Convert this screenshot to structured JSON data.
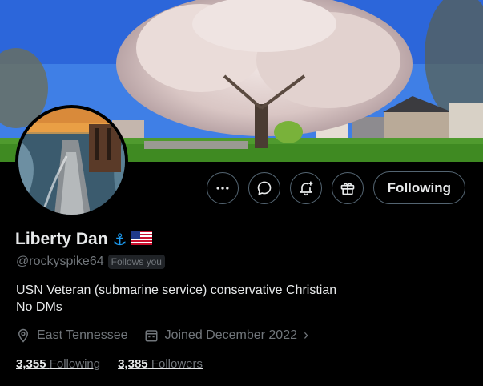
{
  "profile": {
    "display_name": "Liberty Dan",
    "name_emojis": [
      "⚓",
      "🇺🇸"
    ],
    "handle": "@rockyspike64",
    "follows_you_badge": "Follows you",
    "bio_lines": [
      "USN Veteran (submarine service) conservative Christian",
      "No DMs"
    ],
    "location": "East Tennessee",
    "joined": "Joined December 2022",
    "following_count": "3,355",
    "following_label": "Following",
    "followers_count": "3,385",
    "followers_label": "Followers"
  },
  "actions": {
    "more_icon": "more-dots-icon",
    "message_icon": "message-bubble-icon",
    "notify_icon": "bell-plus-icon",
    "subscribe_icon": "gift-icon",
    "follow_button_label": "Following"
  },
  "colors": {
    "background": "#000000",
    "text_primary": "#e7e9ea",
    "text_secondary": "#71767b",
    "border": "#536471",
    "accent_blue": "#1d9bf0"
  }
}
